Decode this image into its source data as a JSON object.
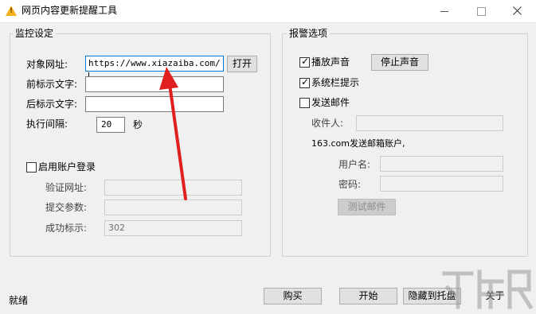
{
  "window": {
    "title": "网页内容更新提醒工具",
    "app_icon_glyph": "!",
    "minimize_glyph": "—",
    "maximize_glyph": "□",
    "close_glyph": "✕"
  },
  "monitor": {
    "group_title": "监控设定",
    "url_label": "对象网址:",
    "url_value": "https://www.xiazaiba.com/",
    "open_button": "打开",
    "prefix_label": "前标示文字:",
    "prefix_value": "",
    "suffix_label": "后标示文字:",
    "suffix_value": "",
    "interval_label": "执行间隔:",
    "interval_value": "20",
    "interval_unit": "秒",
    "enable_login_label": "启用账户登录",
    "enable_login_checked": false,
    "verify_url_label": "验证网址:",
    "verify_url_value": "",
    "submit_params_label": "提交参数:",
    "submit_params_value": "",
    "success_flag_label": "成功标示:",
    "success_flag_value": "302"
  },
  "alarm": {
    "group_title": "报警选项",
    "play_sound_label": "播放声音",
    "play_sound_checked": true,
    "stop_sound_button": "停止声音",
    "tray_tip_label": "系统栏提示",
    "tray_tip_checked": true,
    "send_mail_label": "发送邮件",
    "send_mail_checked": false,
    "recipient_label": "收件人:",
    "recipient_value": "",
    "sender_account_label": "163.com发送邮箱账户,",
    "username_label": "用户名:",
    "username_value": "",
    "password_label": "密码:",
    "password_value": "",
    "test_mail_button": "测试邮件"
  },
  "footer": {
    "status": "就绪",
    "buy_button": "购买",
    "start_button": "开始",
    "hide_tray_button": "隐藏到托盘",
    "about_button": "关于"
  },
  "colors": {
    "annotation_arrow": "#e02020",
    "focus_border": "#0078d7"
  }
}
